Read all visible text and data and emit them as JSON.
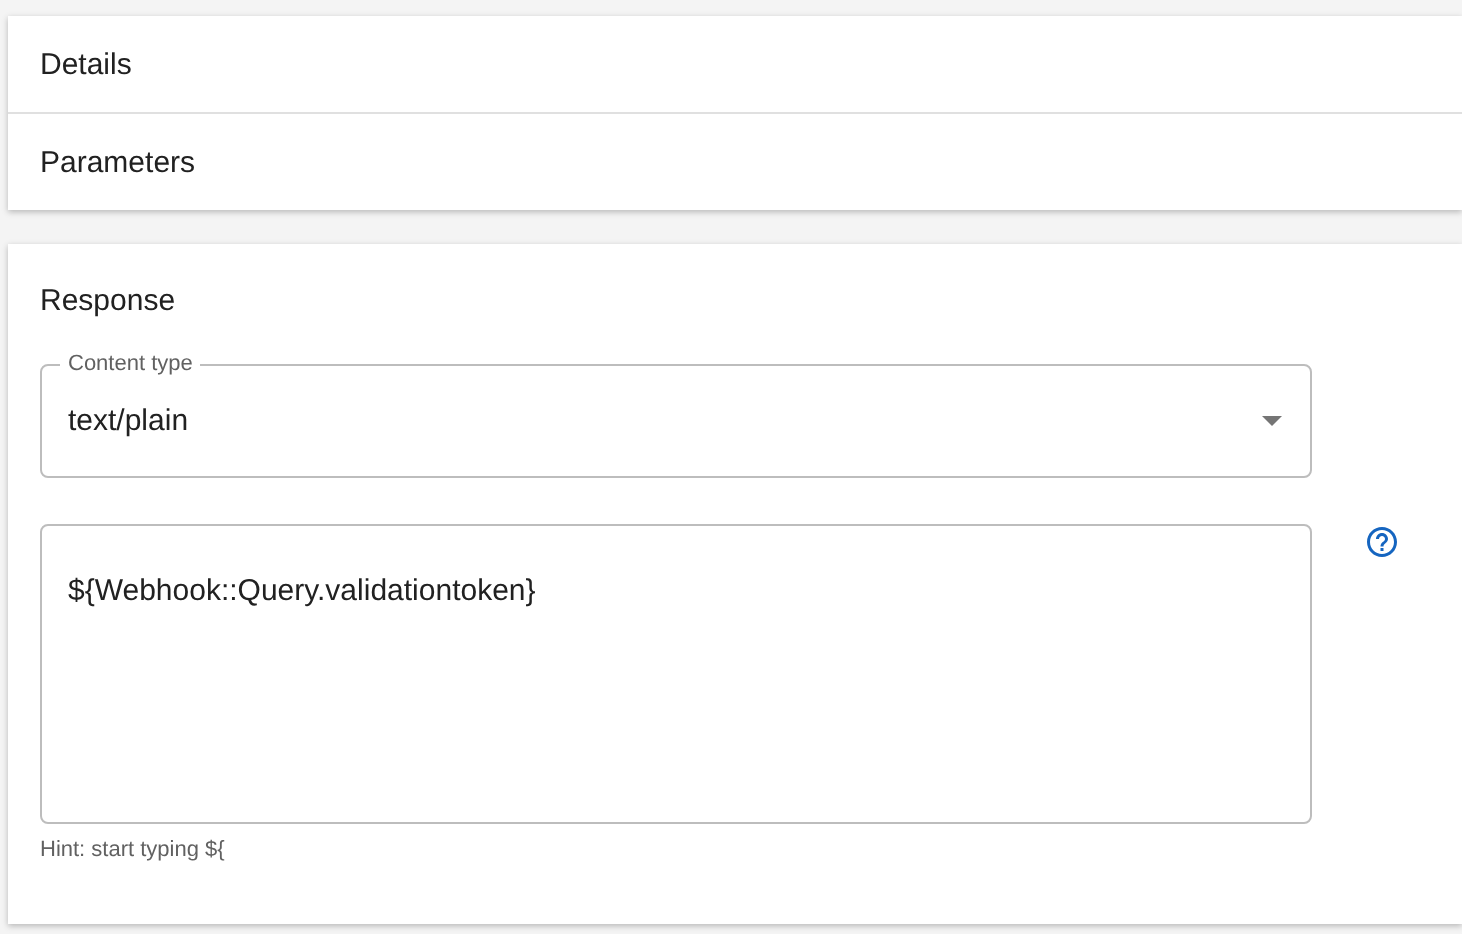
{
  "sections": [
    {
      "title": "Details"
    },
    {
      "title": "Parameters"
    }
  ],
  "response": {
    "title": "Response",
    "content_type": {
      "label": "Content type",
      "value": "text/plain"
    },
    "body": {
      "value": "${Webhook::Query.validationtoken}",
      "hint": "Hint: start typing ${"
    }
  }
}
